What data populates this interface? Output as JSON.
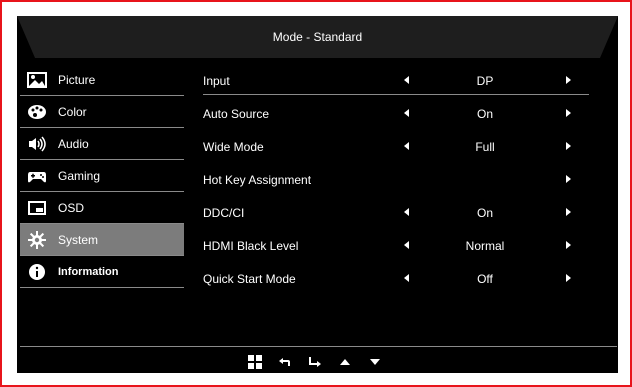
{
  "header": {
    "title": "Mode - Standard"
  },
  "sidebar": {
    "items": [
      {
        "label": "Picture",
        "icon": "picture-icon",
        "active": false
      },
      {
        "label": "Color",
        "icon": "palette-icon",
        "active": false
      },
      {
        "label": "Audio",
        "icon": "speaker-icon",
        "active": false
      },
      {
        "label": "Gaming",
        "icon": "gamepad-icon",
        "active": false
      },
      {
        "label": "OSD",
        "icon": "osd-window-icon",
        "active": false
      },
      {
        "label": "System",
        "icon": "gear-icon",
        "active": true
      },
      {
        "label": "Information",
        "icon": "info-icon",
        "active": false
      }
    ]
  },
  "settings": {
    "rows": [
      {
        "name": "Input",
        "value": "DP"
      },
      {
        "name": "Auto Source",
        "value": "On"
      },
      {
        "name": "Wide Mode",
        "value": "Full"
      },
      {
        "name": "Hot Key Assignment",
        "value": ""
      },
      {
        "name": "DDC/CI",
        "value": "On"
      },
      {
        "name": "HDMI Black Level",
        "value": "Normal"
      },
      {
        "name": "Quick Start Mode",
        "value": "Off"
      }
    ]
  },
  "footer": {
    "buttons": [
      "menu-grid-icon",
      "back-arrow-icon",
      "enter-arrow-icon",
      "up-arrow-icon",
      "down-arrow-icon"
    ]
  },
  "colors": {
    "frame_border": "#e8141b",
    "osd_background": "#000000",
    "active_item": "#7c7c7c"
  }
}
